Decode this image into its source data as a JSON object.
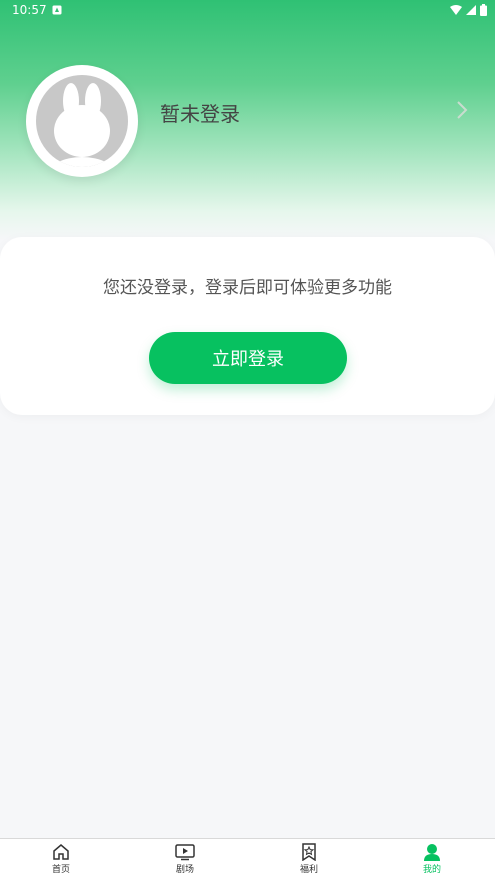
{
  "status_bar": {
    "time": "10:57"
  },
  "profile": {
    "login_status": "暂未登录"
  },
  "card": {
    "message": "您还没登录，登录后即可体验更多功能",
    "button_label": "立即登录"
  },
  "tabs": [
    {
      "label": "首页",
      "icon": "home-icon",
      "active": false
    },
    {
      "label": "剧场",
      "icon": "theater-icon",
      "active": false
    },
    {
      "label": "福利",
      "icon": "welfare-icon",
      "active": false
    },
    {
      "label": "我的",
      "icon": "profile-icon",
      "active": true
    }
  ],
  "colors": {
    "accent": "#07c160",
    "header_gradient_top": "#2fc174"
  }
}
